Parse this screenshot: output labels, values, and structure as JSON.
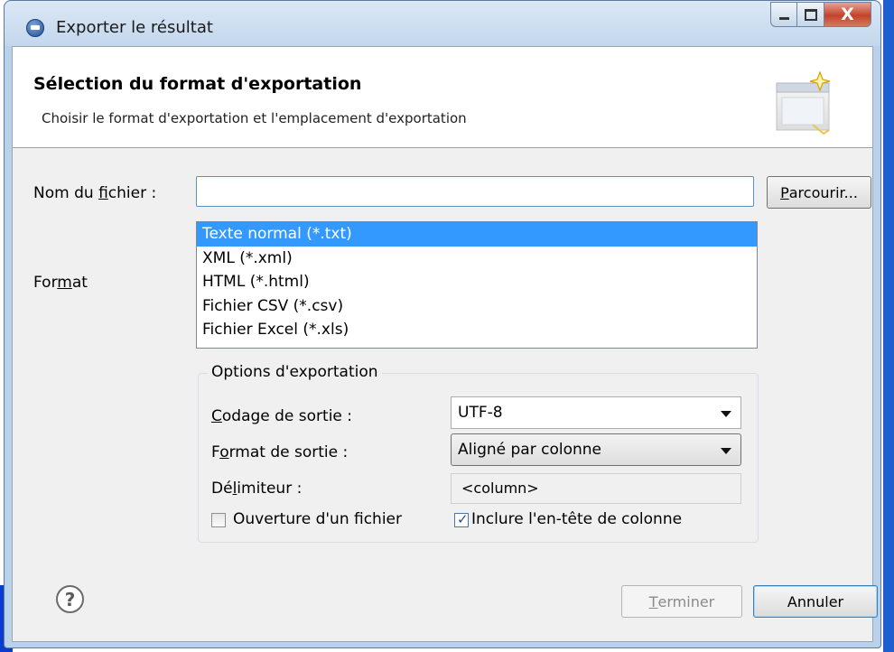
{
  "window": {
    "title": "Exporter le résultat",
    "close_glyph": "X"
  },
  "header": {
    "title": "Sélection du format d'exportation",
    "subtitle": "Choisir le format d'exportation et l'emplacement d'exportation"
  },
  "form": {
    "filename_label_pre": "Nom du ",
    "filename_label_ul": "f",
    "filename_label_post": "ichier :",
    "filename_value": "",
    "browse_label_ul": "P",
    "browse_label_post": "arcourir...",
    "format_label_pre": "For",
    "format_label_ul": "m",
    "format_label_post": "at",
    "format_options": [
      "Texte normal (*.txt)",
      "XML (*.xml)",
      "HTML (*.html)",
      "Fichier CSV (*.csv)",
      "Fichier Excel (*.xls)"
    ],
    "format_selected_index": 0
  },
  "options": {
    "group_title": "Options d'exportation",
    "encoding_label_ul": "C",
    "encoding_label_post": "odage de sortie :",
    "encoding_value": "UTF-8",
    "output_format_label_pre": "F",
    "output_format_label_ul": "o",
    "output_format_label_post": "rmat de sortie :",
    "output_format_value": "Aligné par colonne",
    "delimiter_label_pre": "Dé",
    "delimiter_label_ul": "l",
    "delimiter_label_post": "imiteur :",
    "delimiter_value": "<column>",
    "open_file_label": "Ouverture d'un fichier",
    "open_file_checked": false,
    "include_header_label": "Inclure l'en-tête de colonne",
    "include_header_checked": true
  },
  "footer": {
    "help_glyph": "?",
    "finish_label_ul": "T",
    "finish_label_post": "erminer",
    "finish_enabled": false,
    "cancel_label": "Annuler"
  }
}
